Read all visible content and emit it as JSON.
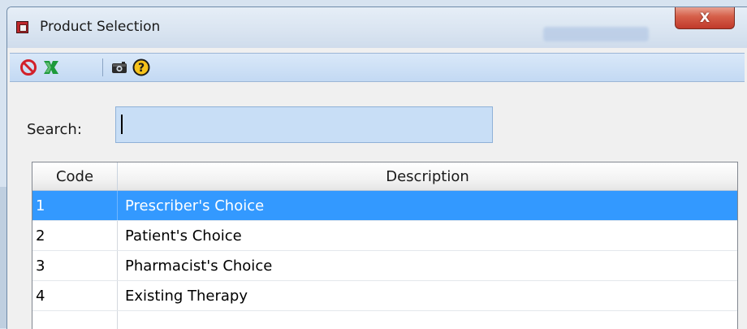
{
  "window": {
    "title": "Product Selection",
    "close_label": "X"
  },
  "toolbar": {
    "icons": [
      "cancel-icon",
      "excel-export-icon",
      "camera-icon",
      "help-icon"
    ]
  },
  "search": {
    "label": "Search:",
    "value": "",
    "placeholder": ""
  },
  "table": {
    "headers": [
      "Code",
      "Description"
    ],
    "rows": [
      {
        "code": "1",
        "description": "Prescriber's Choice",
        "selected": true
      },
      {
        "code": "2",
        "description": "Patient's Choice"
      },
      {
        "code": "3",
        "description": "Pharmacist's Choice"
      },
      {
        "code": "4",
        "description": "Existing Therapy"
      }
    ]
  },
  "colors": {
    "selection": "#3399ff",
    "toolbar": "#c3d9f3",
    "close_button": "#c0392b"
  }
}
